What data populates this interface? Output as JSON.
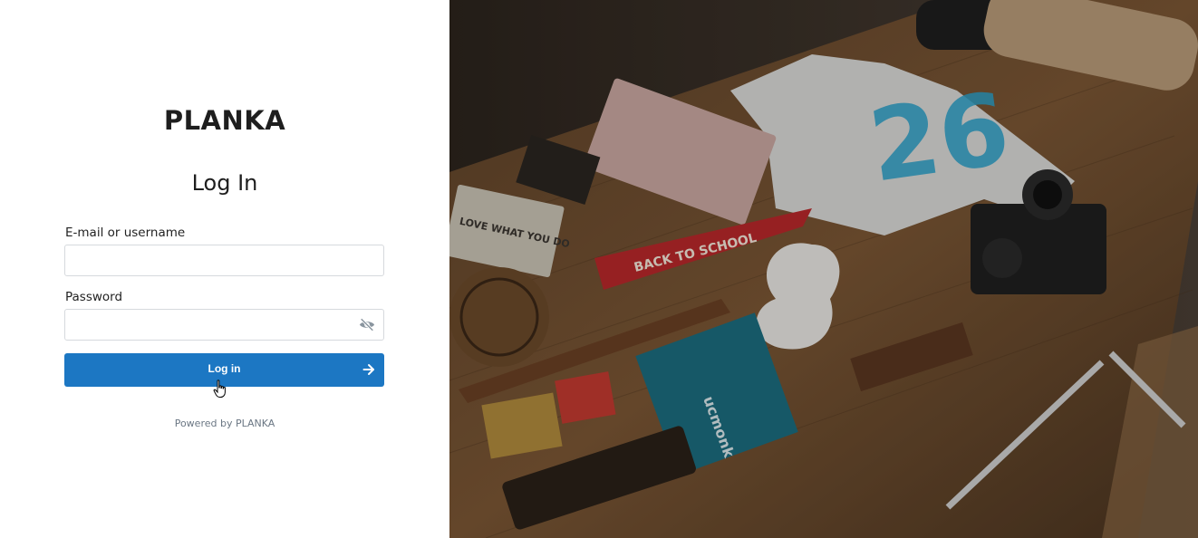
{
  "brand": "PLANKA",
  "heading": "Log In",
  "form": {
    "email_label": "E-mail or username",
    "email_value": "",
    "password_label": "Password",
    "password_value": "",
    "submit_label": "Log in"
  },
  "footer": {
    "powered_by": "Powered by PLANKA"
  },
  "icons": {
    "password_toggle": "eye-slash-icon",
    "submit_arrow": "arrow-right-icon",
    "cursor": "hand-pointer-cursor"
  },
  "colors": {
    "primary_button": "#1c77c3",
    "background": "#ffffff"
  },
  "background_image": {
    "pennant_text": "BACK TO SCHOOL",
    "card_text": "LOVE WHAT YOU DO",
    "notebook_text": "ucmonk",
    "tshirt_text": "26"
  }
}
